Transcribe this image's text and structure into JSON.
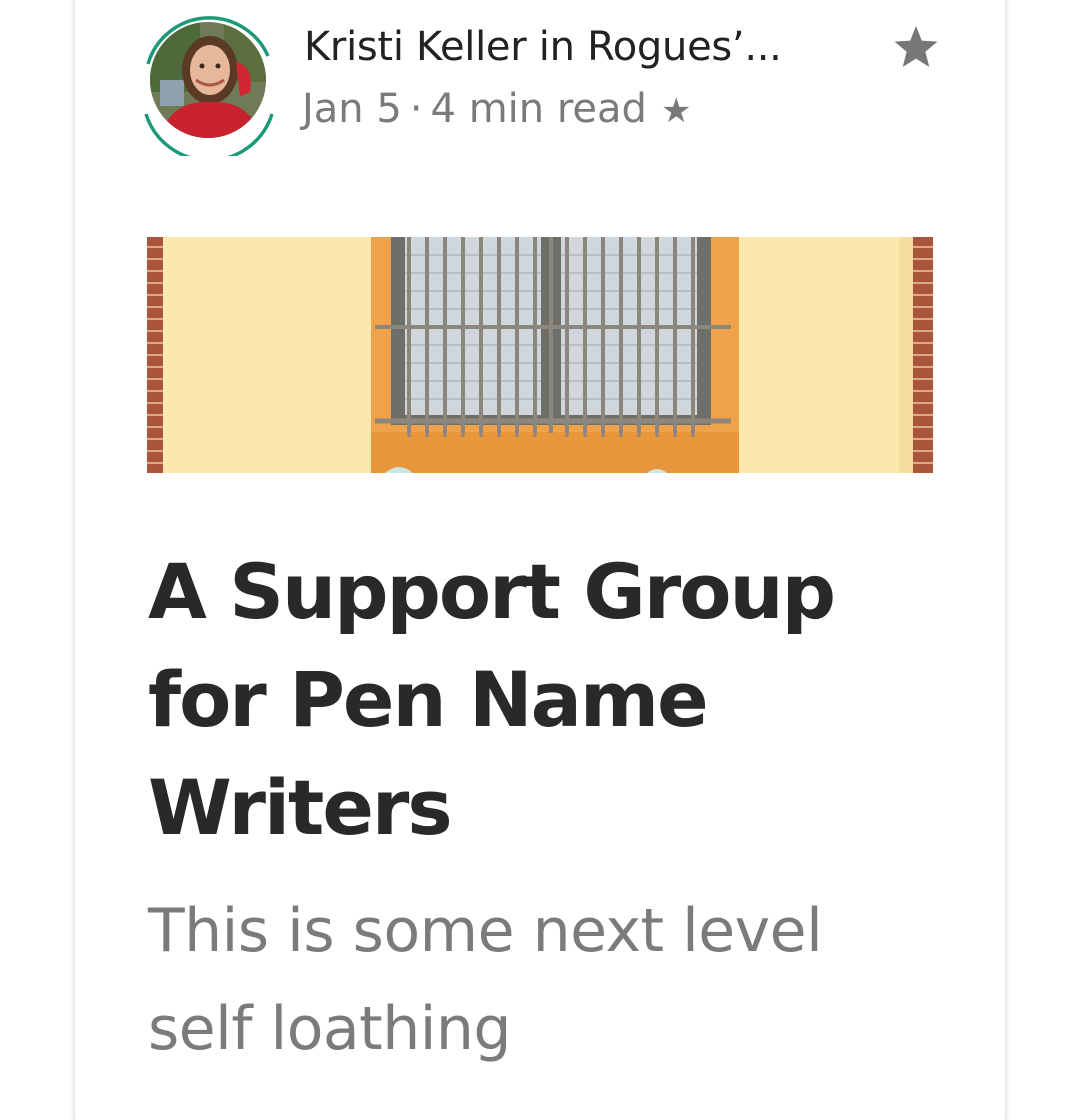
{
  "post": {
    "author_line": "Kristi Keller in Rogues’...",
    "date": "Jan 5",
    "separator": "·",
    "read_time": "4 min read",
    "member_star": "★",
    "title": "A Support Group for Pen Name Writers",
    "subtitle": "This is some next level self loathing"
  },
  "icons": {
    "bookmark": "star-icon",
    "member": "star-icon",
    "avatar_ring": "green-ring"
  },
  "colors": {
    "ring": "#1a9a77",
    "text_primary": "#292929",
    "text_secondary": "#7a7a7a",
    "bookmark": "#777777"
  }
}
